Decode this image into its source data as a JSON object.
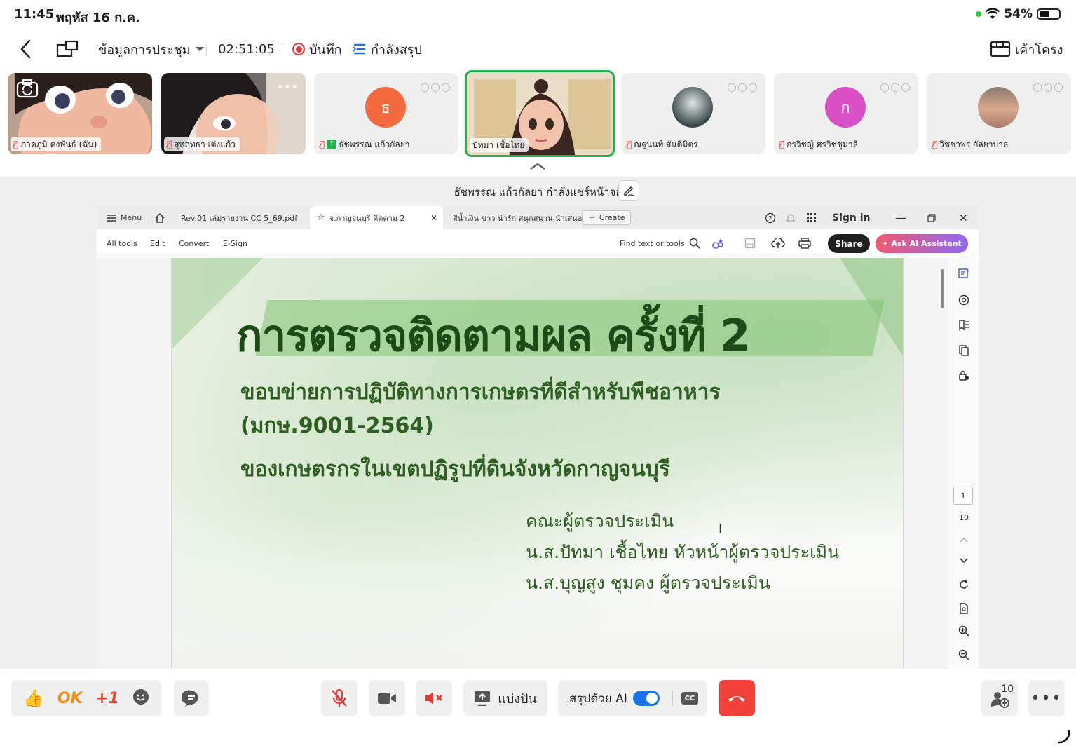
{
  "status_bar": {
    "time": "11:45",
    "date": "พฤหัส 16 ก.ค.",
    "battery": "54%",
    "battery_level": 0.54
  },
  "toolbar": {
    "meeting_info_label": "ข้อมูลการประชุม",
    "duration": "02:51:05",
    "record_label": "บันทึก",
    "summarizing_label": "กำลังสรุป",
    "layout_label": "เค้าโครง"
  },
  "participants": [
    {
      "name": "ภาคภูมิ คงพันธ์ (ฉัน)",
      "type": "video"
    },
    {
      "name": "สุหฤทธา เต่งแก้ว",
      "type": "video"
    },
    {
      "name": "ธัชพรรณ แก้วกัลยา",
      "type": "avatar",
      "initial": "ธ",
      "color": "#f26a3d",
      "sharing": true
    },
    {
      "name": "ปัทมา เชื้อไทย",
      "type": "video",
      "active": true
    },
    {
      "name": "ณฐนนท์ สันติมิตร",
      "type": "photo"
    },
    {
      "name": "กรวิชญ์ ศรวิชชุมาลี",
      "type": "avatar",
      "initial": "ก",
      "color": "#d94fc5"
    },
    {
      "name": "วิชชาพร กัลยาบาล",
      "type": "photo"
    }
  ],
  "share": {
    "sharer_label": "ธัชพรรณ แก้วกัลยา กำลังแชร์หน้าจอ"
  },
  "acrobat": {
    "menu_label": "Menu",
    "tabs": [
      "Rev.01 เล่มรายงาน CC 5_69.pdf",
      "จ.กาญจนบุรี ติดตาม 2",
      "สีน้ำเงิน ขาว น่ารัก สนุกสนาน นำเสนอ โค..."
    ],
    "create_label": "Create",
    "sign_in_label": "Sign in",
    "tools": [
      "All tools",
      "Edit",
      "Convert",
      "E-Sign"
    ],
    "find_label": "Find text or tools",
    "share_label": "Share",
    "ai_label": "Ask AI Assistant",
    "current_page": "1",
    "total_pages": "10"
  },
  "slide": {
    "title": "การตรวจติดตามผล ครั้งที่ 2",
    "line1": "ขอบข่ายการปฏิบัติทางการเกษตรที่ดีสำหรับพืชอาหาร",
    "line2": "(มกษ.9001-2564)",
    "line3": "ของเกษตรกรในเขตปฏิรูปที่ดินจังหวัดกาญจนบุรี",
    "team_heading": "คณะผู้ตรวจประเมิน",
    "team_lead": "น.ส.ปัทมา เชื้อไทย หัวหน้าผู้ตรวจประเมิน",
    "team_member": "น.ส.บุญสูง ชุมคง ผู้ตรวจประเมิน"
  },
  "bottom_bar": {
    "reaction_ok": "OK",
    "reaction_plus_one": "+1",
    "share_screen_label": "แบ่งปัน",
    "ai_summary_label": "สรุปด้วย AI",
    "cc_label": "CC",
    "participant_count": "10"
  },
  "colors": {
    "accent_blue": "#1a73e8",
    "record_red": "#e53935",
    "end_call_red": "#f0403a",
    "active_speaker_green": "#22b14c"
  }
}
